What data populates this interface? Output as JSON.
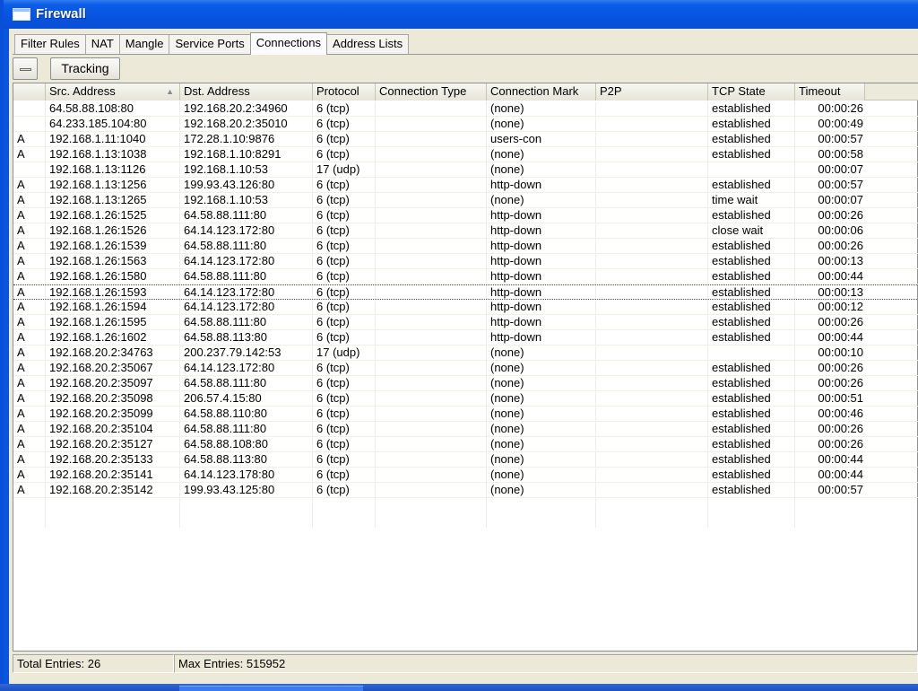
{
  "window": {
    "title": "Firewall"
  },
  "tabs": [
    {
      "label": "Filter Rules",
      "active": false
    },
    {
      "label": "NAT",
      "active": false
    },
    {
      "label": "Mangle",
      "active": false
    },
    {
      "label": "Service Ports",
      "active": false
    },
    {
      "label": "Connections",
      "active": true
    },
    {
      "label": "Address Lists",
      "active": false
    }
  ],
  "toolbar": {
    "remove_icon": "minus-icon",
    "tracking_label": "Tracking"
  },
  "table": {
    "sorted_by": "Src. Address",
    "columns": [
      "",
      "Src. Address",
      "Dst. Address",
      "Protocol",
      "Connection Type",
      "Connection Mark",
      "P2P",
      "TCP State",
      "Timeout"
    ],
    "focused_row": 12,
    "rows": [
      [
        "",
        "64.58.88.108:80",
        "192.168.20.2:34960",
        "6 (tcp)",
        "",
        "(none)",
        "",
        "established",
        "00:00:26"
      ],
      [
        "",
        "64.233.185.104:80",
        "192.168.20.2:35010",
        "6 (tcp)",
        "",
        "(none)",
        "",
        "established",
        "00:00:49"
      ],
      [
        "A",
        "192.168.1.11:1040",
        "172.28.1.10:9876",
        "6 (tcp)",
        "",
        "users-con",
        "",
        "established",
        "00:00:57"
      ],
      [
        "A",
        "192.168.1.13:1038",
        "192.168.1.10:8291",
        "6 (tcp)",
        "",
        "(none)",
        "",
        "established",
        "00:00:58"
      ],
      [
        "",
        "192.168.1.13:1126",
        "192.168.1.10:53",
        "17 (udp)",
        "",
        "(none)",
        "",
        "",
        "00:00:07"
      ],
      [
        "A",
        "192.168.1.13:1256",
        "199.93.43.126:80",
        "6 (tcp)",
        "",
        "http-down",
        "",
        "established",
        "00:00:57"
      ],
      [
        "A",
        "192.168.1.13:1265",
        "192.168.1.10:53",
        "6 (tcp)",
        "",
        "(none)",
        "",
        "time wait",
        "00:00:07"
      ],
      [
        "A",
        "192.168.1.26:1525",
        "64.58.88.111:80",
        "6 (tcp)",
        "",
        "http-down",
        "",
        "established",
        "00:00:26"
      ],
      [
        "A",
        "192.168.1.26:1526",
        "64.14.123.172:80",
        "6 (tcp)",
        "",
        "http-down",
        "",
        "close wait",
        "00:00:06"
      ],
      [
        "A",
        "192.168.1.26:1539",
        "64.58.88.111:80",
        "6 (tcp)",
        "",
        "http-down",
        "",
        "established",
        "00:00:26"
      ],
      [
        "A",
        "192.168.1.26:1563",
        "64.14.123.172:80",
        "6 (tcp)",
        "",
        "http-down",
        "",
        "established",
        "00:00:13"
      ],
      [
        "A",
        "192.168.1.26:1580",
        "64.58.88.111:80",
        "6 (tcp)",
        "",
        "http-down",
        "",
        "established",
        "00:00:44"
      ],
      [
        "A",
        "192.168.1.26:1593",
        "64.14.123.172:80",
        "6 (tcp)",
        "",
        "http-down",
        "",
        "established",
        "00:00:13"
      ],
      [
        "A",
        "192.168.1.26:1594",
        "64.14.123.172:80",
        "6 (tcp)",
        "",
        "http-down",
        "",
        "established",
        "00:00:12"
      ],
      [
        "A",
        "192.168.1.26:1595",
        "64.58.88.111:80",
        "6 (tcp)",
        "",
        "http-down",
        "",
        "established",
        "00:00:26"
      ],
      [
        "A",
        "192.168.1.26:1602",
        "64.58.88.113:80",
        "6 (tcp)",
        "",
        "http-down",
        "",
        "established",
        "00:00:44"
      ],
      [
        "A",
        "192.168.20.2:34763",
        "200.237.79.142:53",
        "17 (udp)",
        "",
        "(none)",
        "",
        "",
        "00:00:10"
      ],
      [
        "A",
        "192.168.20.2:35067",
        "64.14.123.172:80",
        "6 (tcp)",
        "",
        "(none)",
        "",
        "established",
        "00:00:26"
      ],
      [
        "A",
        "192.168.20.2:35097",
        "64.58.88.111:80",
        "6 (tcp)",
        "",
        "(none)",
        "",
        "established",
        "00:00:26"
      ],
      [
        "A",
        "192.168.20.2:35098",
        "206.57.4.15:80",
        "6 (tcp)",
        "",
        "(none)",
        "",
        "established",
        "00:00:51"
      ],
      [
        "A",
        "192.168.20.2:35099",
        "64.58.88.110:80",
        "6 (tcp)",
        "",
        "(none)",
        "",
        "established",
        "00:00:46"
      ],
      [
        "A",
        "192.168.20.2:35104",
        "64.58.88.111:80",
        "6 (tcp)",
        "",
        "(none)",
        "",
        "established",
        "00:00:26"
      ],
      [
        "A",
        "192.168.20.2:35127",
        "64.58.88.108:80",
        "6 (tcp)",
        "",
        "(none)",
        "",
        "established",
        "00:00:26"
      ],
      [
        "A",
        "192.168.20.2:35133",
        "64.58.88.113:80",
        "6 (tcp)",
        "",
        "(none)",
        "",
        "established",
        "00:00:44"
      ],
      [
        "A",
        "192.168.20.2:35141",
        "64.14.123.178:80",
        "6 (tcp)",
        "",
        "(none)",
        "",
        "established",
        "00:00:44"
      ],
      [
        "A",
        "192.168.20.2:35142",
        "199.93.43.125:80",
        "6 (tcp)",
        "",
        "(none)",
        "",
        "established",
        "00:00:57"
      ]
    ]
  },
  "status": {
    "total": "Total Entries: 26",
    "max": "Max Entries: 515952"
  }
}
